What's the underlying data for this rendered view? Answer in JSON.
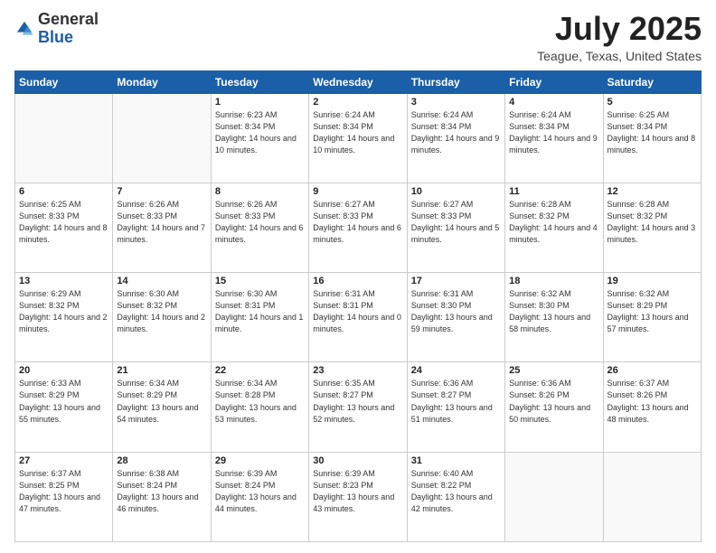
{
  "header": {
    "logo_general": "General",
    "logo_blue": "Blue",
    "month_title": "July 2025",
    "location": "Teague, Texas, United States"
  },
  "weekdays": [
    "Sunday",
    "Monday",
    "Tuesday",
    "Wednesday",
    "Thursday",
    "Friday",
    "Saturday"
  ],
  "weeks": [
    [
      {
        "day": "",
        "info": ""
      },
      {
        "day": "",
        "info": ""
      },
      {
        "day": "1",
        "info": "Sunrise: 6:23 AM\nSunset: 8:34 PM\nDaylight: 14 hours and 10 minutes."
      },
      {
        "day": "2",
        "info": "Sunrise: 6:24 AM\nSunset: 8:34 PM\nDaylight: 14 hours and 10 minutes."
      },
      {
        "day": "3",
        "info": "Sunrise: 6:24 AM\nSunset: 8:34 PM\nDaylight: 14 hours and 9 minutes."
      },
      {
        "day": "4",
        "info": "Sunrise: 6:24 AM\nSunset: 8:34 PM\nDaylight: 14 hours and 9 minutes."
      },
      {
        "day": "5",
        "info": "Sunrise: 6:25 AM\nSunset: 8:34 PM\nDaylight: 14 hours and 8 minutes."
      }
    ],
    [
      {
        "day": "6",
        "info": "Sunrise: 6:25 AM\nSunset: 8:33 PM\nDaylight: 14 hours and 8 minutes."
      },
      {
        "day": "7",
        "info": "Sunrise: 6:26 AM\nSunset: 8:33 PM\nDaylight: 14 hours and 7 minutes."
      },
      {
        "day": "8",
        "info": "Sunrise: 6:26 AM\nSunset: 8:33 PM\nDaylight: 14 hours and 6 minutes."
      },
      {
        "day": "9",
        "info": "Sunrise: 6:27 AM\nSunset: 8:33 PM\nDaylight: 14 hours and 6 minutes."
      },
      {
        "day": "10",
        "info": "Sunrise: 6:27 AM\nSunset: 8:33 PM\nDaylight: 14 hours and 5 minutes."
      },
      {
        "day": "11",
        "info": "Sunrise: 6:28 AM\nSunset: 8:32 PM\nDaylight: 14 hours and 4 minutes."
      },
      {
        "day": "12",
        "info": "Sunrise: 6:28 AM\nSunset: 8:32 PM\nDaylight: 14 hours and 3 minutes."
      }
    ],
    [
      {
        "day": "13",
        "info": "Sunrise: 6:29 AM\nSunset: 8:32 PM\nDaylight: 14 hours and 2 minutes."
      },
      {
        "day": "14",
        "info": "Sunrise: 6:30 AM\nSunset: 8:32 PM\nDaylight: 14 hours and 2 minutes."
      },
      {
        "day": "15",
        "info": "Sunrise: 6:30 AM\nSunset: 8:31 PM\nDaylight: 14 hours and 1 minute."
      },
      {
        "day": "16",
        "info": "Sunrise: 6:31 AM\nSunset: 8:31 PM\nDaylight: 14 hours and 0 minutes."
      },
      {
        "day": "17",
        "info": "Sunrise: 6:31 AM\nSunset: 8:30 PM\nDaylight: 13 hours and 59 minutes."
      },
      {
        "day": "18",
        "info": "Sunrise: 6:32 AM\nSunset: 8:30 PM\nDaylight: 13 hours and 58 minutes."
      },
      {
        "day": "19",
        "info": "Sunrise: 6:32 AM\nSunset: 8:29 PM\nDaylight: 13 hours and 57 minutes."
      }
    ],
    [
      {
        "day": "20",
        "info": "Sunrise: 6:33 AM\nSunset: 8:29 PM\nDaylight: 13 hours and 55 minutes."
      },
      {
        "day": "21",
        "info": "Sunrise: 6:34 AM\nSunset: 8:29 PM\nDaylight: 13 hours and 54 minutes."
      },
      {
        "day": "22",
        "info": "Sunrise: 6:34 AM\nSunset: 8:28 PM\nDaylight: 13 hours and 53 minutes."
      },
      {
        "day": "23",
        "info": "Sunrise: 6:35 AM\nSunset: 8:27 PM\nDaylight: 13 hours and 52 minutes."
      },
      {
        "day": "24",
        "info": "Sunrise: 6:36 AM\nSunset: 8:27 PM\nDaylight: 13 hours and 51 minutes."
      },
      {
        "day": "25",
        "info": "Sunrise: 6:36 AM\nSunset: 8:26 PM\nDaylight: 13 hours and 50 minutes."
      },
      {
        "day": "26",
        "info": "Sunrise: 6:37 AM\nSunset: 8:26 PM\nDaylight: 13 hours and 48 minutes."
      }
    ],
    [
      {
        "day": "27",
        "info": "Sunrise: 6:37 AM\nSunset: 8:25 PM\nDaylight: 13 hours and 47 minutes."
      },
      {
        "day": "28",
        "info": "Sunrise: 6:38 AM\nSunset: 8:24 PM\nDaylight: 13 hours and 46 minutes."
      },
      {
        "day": "29",
        "info": "Sunrise: 6:39 AM\nSunset: 8:24 PM\nDaylight: 13 hours and 44 minutes."
      },
      {
        "day": "30",
        "info": "Sunrise: 6:39 AM\nSunset: 8:23 PM\nDaylight: 13 hours and 43 minutes."
      },
      {
        "day": "31",
        "info": "Sunrise: 6:40 AM\nSunset: 8:22 PM\nDaylight: 13 hours and 42 minutes."
      },
      {
        "day": "",
        "info": ""
      },
      {
        "day": "",
        "info": ""
      }
    ]
  ]
}
